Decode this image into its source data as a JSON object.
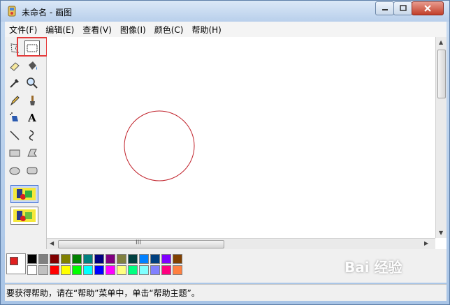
{
  "window": {
    "title": "未命名 - 画图",
    "controls": {
      "minimize_icon": "minimize-icon",
      "maximize_icon": "maximize-icon",
      "close_icon": "close-icon"
    }
  },
  "menu": {
    "items": [
      "文件(F)",
      "编辑(E)",
      "查看(V)",
      "图像(I)",
      "颜色(C)",
      "帮助(H)"
    ]
  },
  "tools": [
    {
      "name": "free-select-icon"
    },
    {
      "name": "rect-select-icon",
      "selected": true
    },
    {
      "name": "eraser-icon"
    },
    {
      "name": "fill-icon"
    },
    {
      "name": "color-picker-icon"
    },
    {
      "name": "magnifier-icon"
    },
    {
      "name": "pencil-icon"
    },
    {
      "name": "brush-icon"
    },
    {
      "name": "airbrush-icon"
    },
    {
      "name": "text-icon",
      "glyph": "A"
    },
    {
      "name": "line-icon"
    },
    {
      "name": "curve-icon"
    },
    {
      "name": "rectangle-icon"
    },
    {
      "name": "polygon-icon"
    },
    {
      "name": "ellipse-icon"
    },
    {
      "name": "rounded-rect-icon"
    }
  ],
  "canvas": {
    "shape": "circle",
    "stroke_color": "#c0212a"
  },
  "scrollbar": {
    "h_thumb_glyph": "III"
  },
  "palette": {
    "foreground": "#e02020",
    "background": "#ffffff",
    "row1": [
      "#000000",
      "#808080",
      "#800000",
      "#808000",
      "#008000",
      "#008080",
      "#000080",
      "#800080",
      "#808040",
      "#004040",
      "#0080ff",
      "#004080",
      "#8000ff",
      "#804000"
    ],
    "row2": [
      "#ffffff",
      "#c0c0c0",
      "#ff0000",
      "#ffff00",
      "#00ff00",
      "#00ffff",
      "#0000ff",
      "#ff00ff",
      "#ffff80",
      "#00ff80",
      "#80ffff",
      "#8080ff",
      "#ff0080",
      "#ff8040"
    ]
  },
  "status": {
    "text": "要获得帮助，请在“帮助”菜单中，单击“帮助主题”。"
  },
  "watermark": {
    "text": "Bai 经验"
  }
}
